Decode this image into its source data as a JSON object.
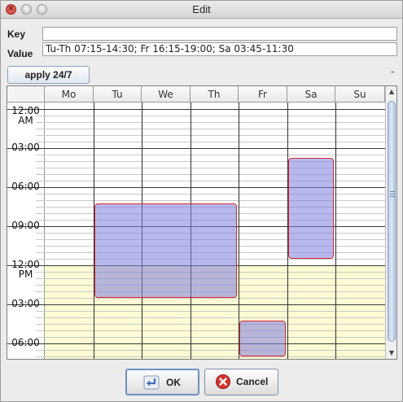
{
  "window": {
    "title": "Edit"
  },
  "form": {
    "key_label": "Key",
    "key_value": "",
    "value_label": "Value",
    "value_value": "Tu-Th 07:15-14:30; Fr 16:15-19:00; Sa 03:45-11:30"
  },
  "toolbar": {
    "apply_label": "apply 24/7",
    "collapse_label": "-"
  },
  "schedule": {
    "days": [
      "Mo",
      "Tu",
      "We",
      "Th",
      "Fr",
      "Sa",
      "Su"
    ],
    "time_labels": [
      {
        "hour": 0,
        "line1": "12:00",
        "line2": "AM"
      },
      {
        "hour": 3,
        "line1": "03:00",
        "line2": ""
      },
      {
        "hour": 6,
        "line1": "06:00",
        "line2": ""
      },
      {
        "hour": 9,
        "line1": "09:00",
        "line2": ""
      },
      {
        "hour": 12,
        "line1": "12:00",
        "line2": "PM"
      },
      {
        "hour": 15,
        "line1": "03:00",
        "line2": ""
      },
      {
        "hour": 18,
        "line1": "06:00",
        "line2": ""
      }
    ],
    "colors": {
      "pm_background": "#fdfbd3",
      "block_fill": "#8c8ce0",
      "block_border": "#d8283a"
    },
    "blocks": [
      {
        "days": [
          "Tu",
          "We",
          "Th"
        ],
        "start": "07:15",
        "end": "14:30"
      },
      {
        "days": [
          "Fr"
        ],
        "start": "16:15",
        "end": "19:00"
      },
      {
        "days": [
          "Sa"
        ],
        "start": "03:45",
        "end": "11:30"
      }
    ]
  },
  "buttons": {
    "ok_label": "OK",
    "cancel_label": "Cancel"
  }
}
